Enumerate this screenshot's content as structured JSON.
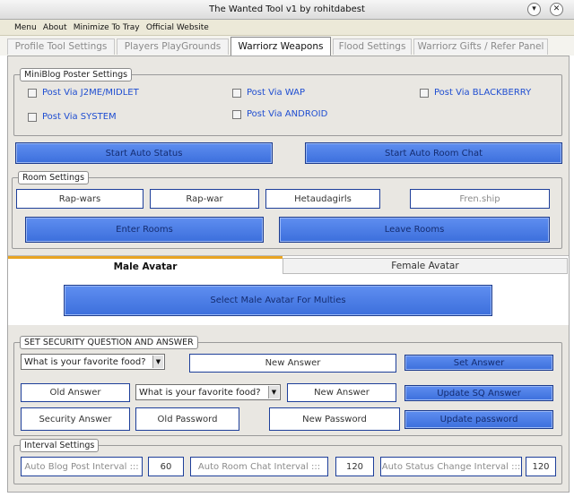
{
  "window": {
    "title": "The Wanted Tool v1 by rohitdabest",
    "dropdown_icon": "chevron-down-circle-icon",
    "close_icon": "close-circle-icon"
  },
  "menu": [
    "Menu",
    "About",
    "Minimize To Tray",
    "Official Website"
  ],
  "tabs": [
    {
      "label": "Profile Tool Settings"
    },
    {
      "label": "Players PlayGrounds"
    },
    {
      "label": "Warriorz Weapons"
    },
    {
      "label": "Flood Settings"
    },
    {
      "label": "Warriorz Gifts / Refer Panel"
    }
  ],
  "miniblog": {
    "legend": "MiniBlog Poster Settings",
    "options": [
      "Post Via J2ME/MIDLET",
      "Post Via WAP",
      "Post Via BLACKBERRY",
      "Post Via SYSTEM",
      "Post Via ANDROID"
    ]
  },
  "auto_status_button": "Start Auto Status",
  "auto_room_chat_button": "Start Auto Room Chat",
  "rooms": {
    "legend": "Room Settings",
    "fields": [
      "Rap-wars",
      "Rap-war",
      "Hetaudagirls",
      "Fren.ship"
    ],
    "enter_button": "Enter Rooms",
    "leave_button": "Leave Rooms"
  },
  "avatar": {
    "tab_male": "Male Avatar",
    "tab_female": "Female Avatar",
    "select_button": "Select Male Avatar For Multies"
  },
  "security": {
    "legend": "SET SECURITY QUESTION AND ANSWER",
    "question_select": "What is your favorite food?",
    "new_answer": "New Answer",
    "set_answer_button": "Set Answer",
    "old_answer": "Old Answer",
    "question_select_2": "What is your favorite food?",
    "new_answer_2": "New Answer",
    "update_sq_button": "Update SQ Answer",
    "security_answer": "Security Answer",
    "old_password": "Old Password",
    "new_password": "New Password",
    "update_password_button": "Update password"
  },
  "interval": {
    "legend": "Interval Settings",
    "blog_label": "Auto Blog Post Interval :::",
    "blog_value": "60",
    "room_label": "Auto Room Chat Interval :::",
    "room_value": "120",
    "status_label": "Auto Status Change Interval :::",
    "status_value": "120"
  },
  "colors": {
    "button_blue": "#4a7be6",
    "field_border": "#1e3f9a",
    "checkbox_label": "#1f4ed1",
    "tab_accent": "#e8a423"
  }
}
